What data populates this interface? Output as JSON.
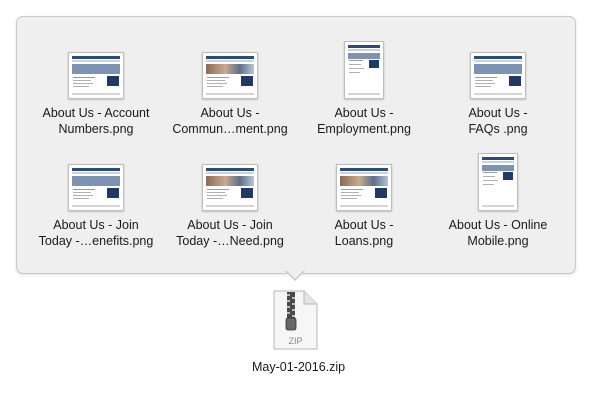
{
  "popover": {
    "items": [
      {
        "line1": "About Us - Account",
        "line2": "Numbers.png",
        "orientation": "land",
        "hero": "plain"
      },
      {
        "line1": "About Us -",
        "line2": "Commun…ment.png",
        "orientation": "land",
        "hero": "people"
      },
      {
        "line1": "About Us -",
        "line2": "Employment.png",
        "orientation": "port",
        "hero": "plain"
      },
      {
        "line1": "About Us -",
        "line2": "FAQs .png",
        "orientation": "land",
        "hero": "plain"
      },
      {
        "line1": "About Us - Join",
        "line2": "Today -…enefits.png",
        "orientation": "land",
        "hero": "plain"
      },
      {
        "line1": "About Us - Join",
        "line2": "Today -…Need.png",
        "orientation": "land",
        "hero": "people"
      },
      {
        "line1": "About Us -",
        "line2": "Loans.png",
        "orientation": "land",
        "hero": "people"
      },
      {
        "line1": "About Us - Online",
        "line2": "Mobile.png",
        "orientation": "port",
        "hero": "plain"
      }
    ]
  },
  "zip": {
    "filename": "May-01-2016.zip",
    "badge": "ZIP",
    "icon": "zip-archive-icon"
  }
}
